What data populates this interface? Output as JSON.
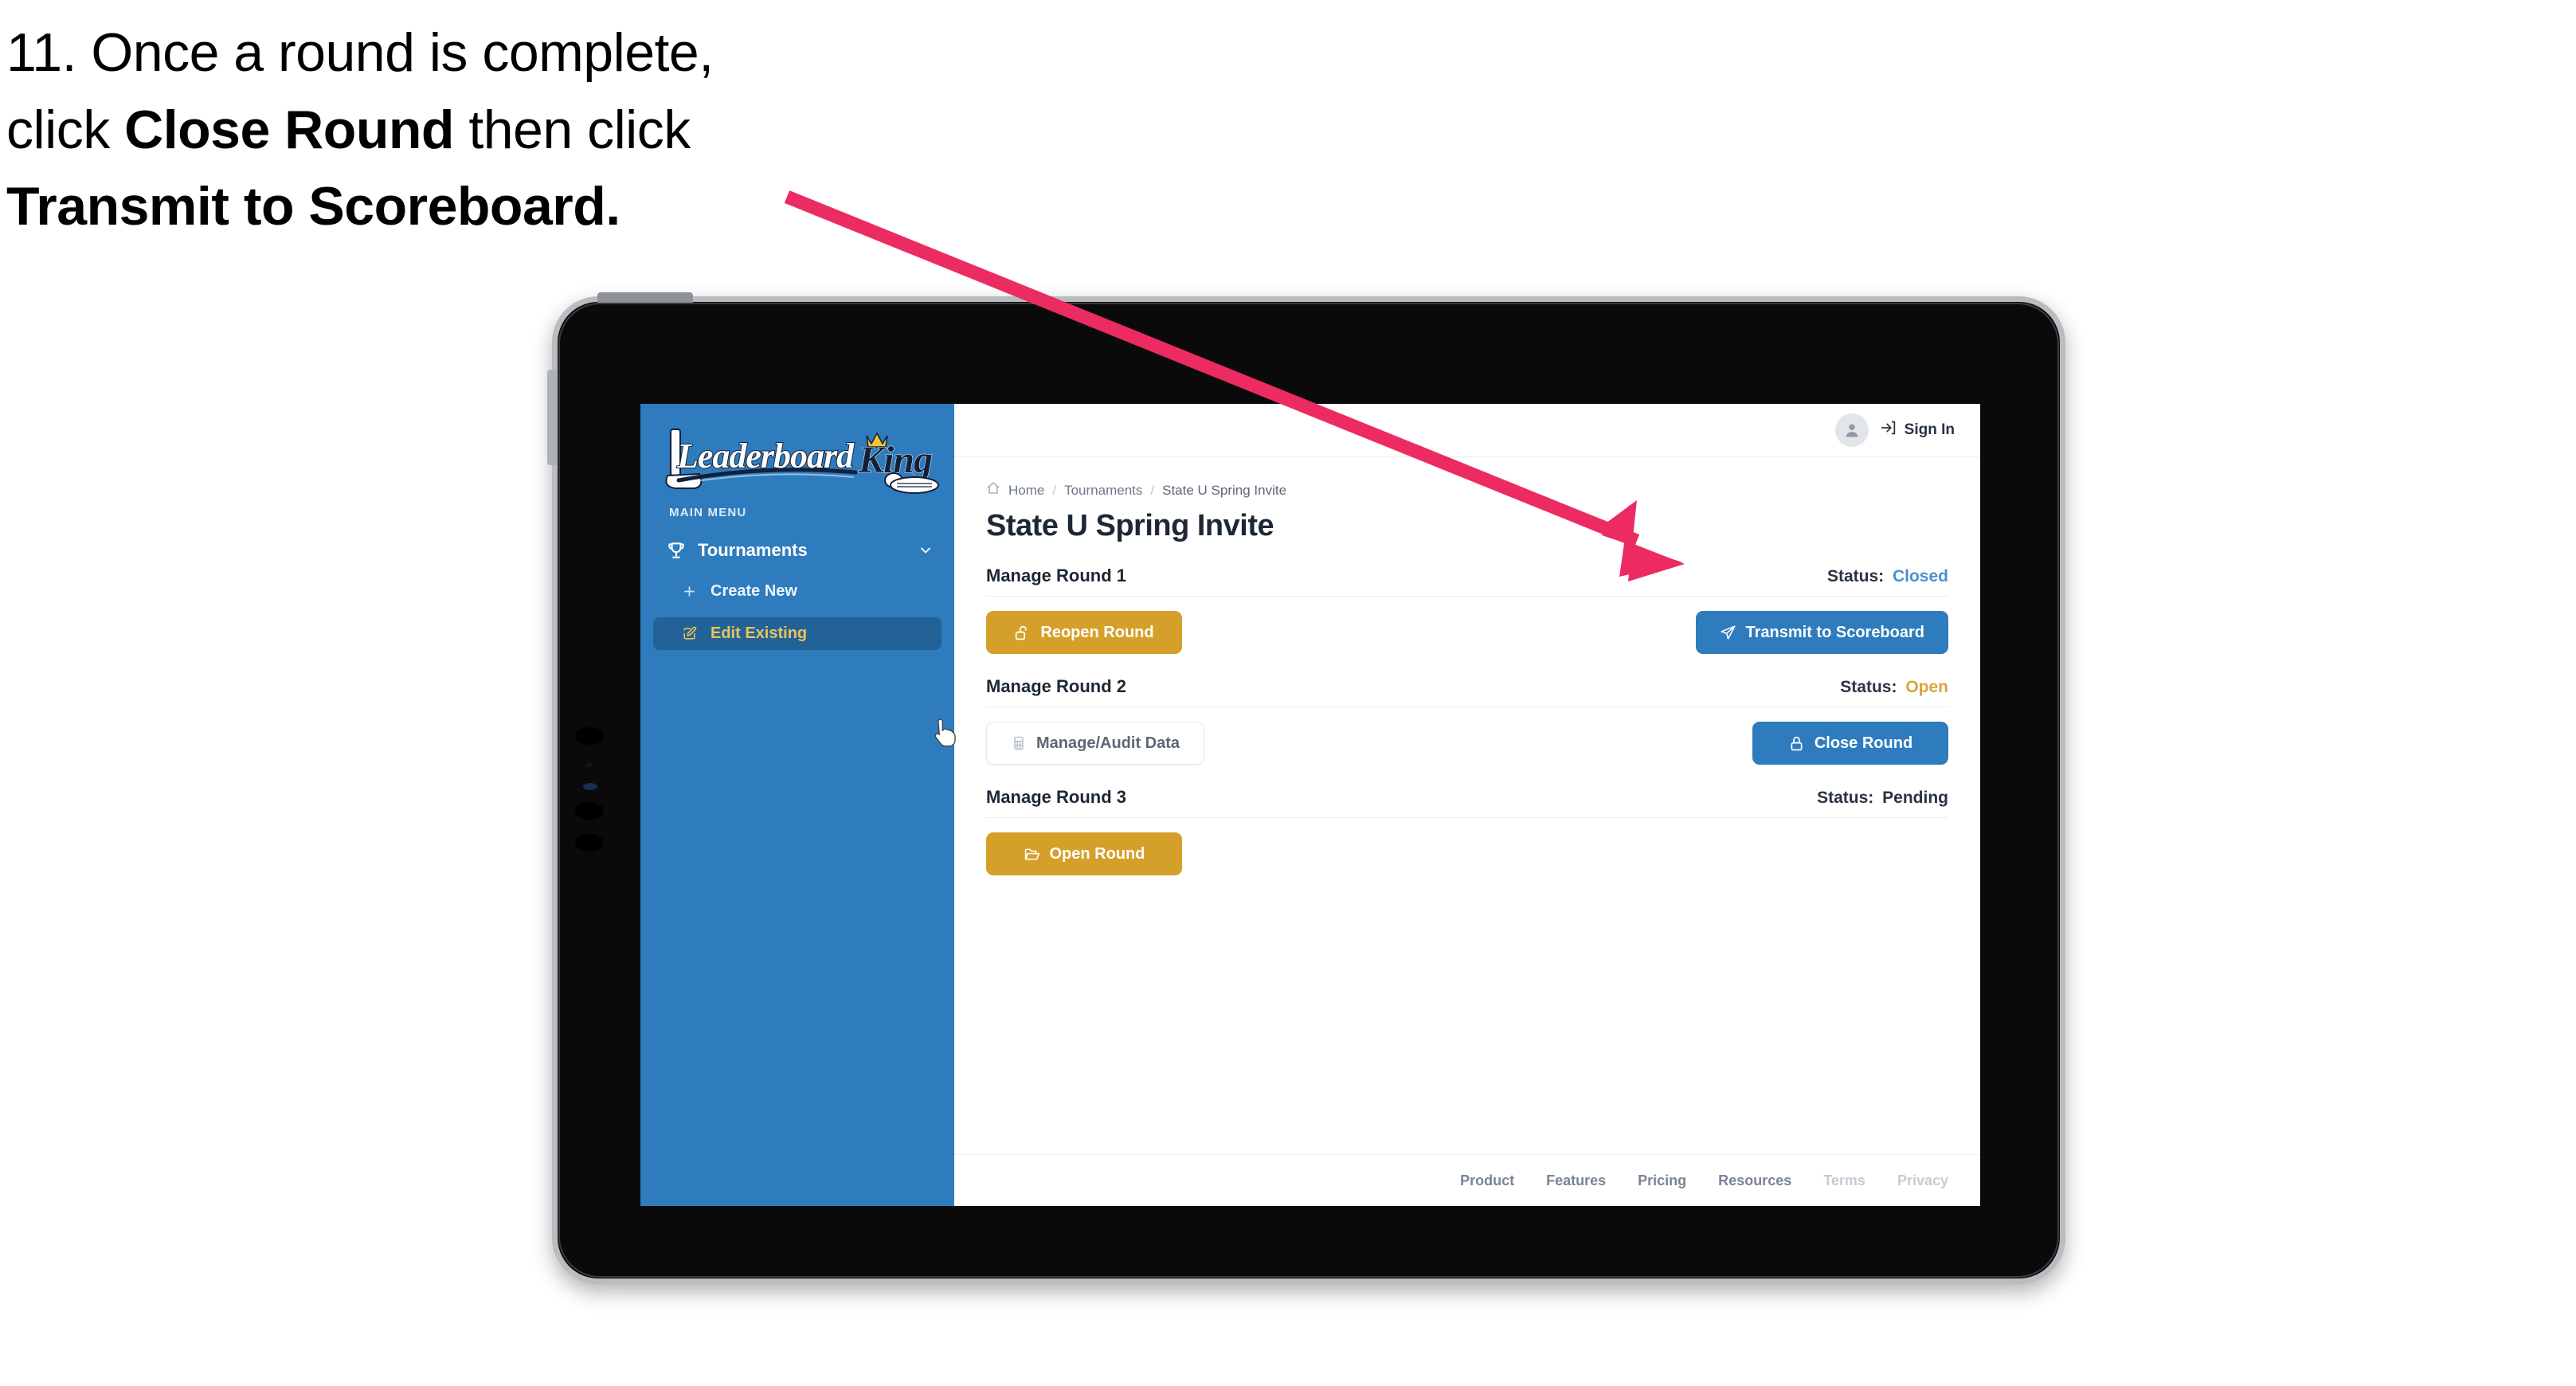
{
  "caption": {
    "step_number": "11.",
    "line1_pre": "11. Once a round is complete,",
    "line2_pre": "click ",
    "line2_bold": "Close Round",
    "line2_post": " then click",
    "line3_bold": "Transmit to Scoreboard."
  },
  "brand": {
    "logo_text_primary": "Leaderboard",
    "logo_text_secondary": "King",
    "logo_icon": "golf-club-crown-ball-logo",
    "sidebar_color": "#2e7cbd",
    "gold_color": "#d4a029",
    "blue_color": "#2e7cbd",
    "arrow_color": "#ec2b62"
  },
  "sidebar": {
    "menu_label": "MAIN MENU",
    "nav": {
      "label": "Tournaments",
      "icon": "trophy-icon",
      "chevron": "chevron-down-icon"
    },
    "items": [
      {
        "label": "Create New",
        "icon": "plus-icon",
        "active": false
      },
      {
        "label": "Edit Existing",
        "icon": "edit-square-icon",
        "active": true
      }
    ]
  },
  "topbar": {
    "avatar_icon": "user-avatar-icon",
    "signin_icon": "sign-in-arrow-icon",
    "signin_label": "Sign In"
  },
  "breadcrumb": {
    "home_icon": "home-icon",
    "items": [
      "Home",
      "Tournaments",
      "State U Spring Invite"
    ],
    "separator": "/"
  },
  "page": {
    "title": "State U Spring Invite"
  },
  "rounds": [
    {
      "title": "Manage Round 1",
      "status_label": "Status:",
      "status_value": "Closed",
      "status_color": "#4a8fd0",
      "left_button": {
        "label": "Reopen Round",
        "icon": "unlock-icon",
        "style": "gold"
      },
      "right_button": {
        "label": "Transmit to Scoreboard",
        "icon": "paper-plane-icon",
        "style": "blue"
      }
    },
    {
      "title": "Manage Round 2",
      "status_label": "Status:",
      "status_value": "Open",
      "status_color": "#d9a43c",
      "left_button": {
        "label": "Manage/Audit Data",
        "icon": "table-grid-icon",
        "style": "ghost"
      },
      "right_button": {
        "label": "Close Round",
        "icon": "lock-icon",
        "style": "blue"
      }
    },
    {
      "title": "Manage Round 3",
      "status_label": "Status:",
      "status_value": "Pending",
      "status_color": "#2a3342",
      "left_button": {
        "label": "Open Round",
        "icon": "folder-open-icon",
        "style": "gold"
      },
      "right_button": null
    }
  ],
  "footer": {
    "links": [
      {
        "label": "Product",
        "muted": false
      },
      {
        "label": "Features",
        "muted": false
      },
      {
        "label": "Pricing",
        "muted": false
      },
      {
        "label": "Resources",
        "muted": false
      },
      {
        "label": "Terms",
        "muted": true
      },
      {
        "label": "Privacy",
        "muted": true
      }
    ]
  },
  "cursor": {
    "type": "pointing-hand-cursor"
  }
}
